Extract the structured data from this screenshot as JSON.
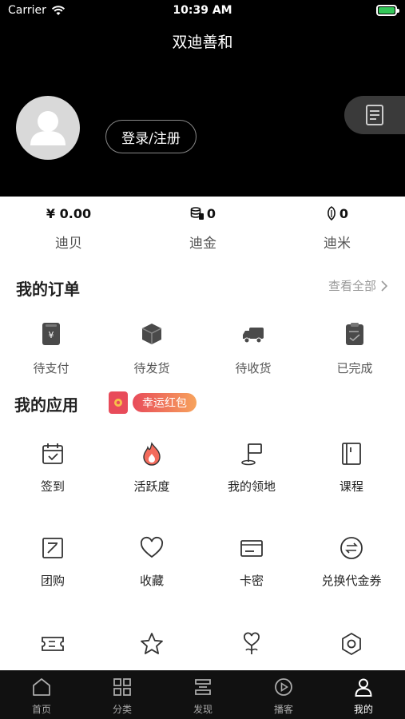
{
  "status_bar": {
    "carrier": "Carrier",
    "time": "10:39 AM"
  },
  "header": {
    "title": "双迪善和",
    "login_label": "登录/注册"
  },
  "wallet": [
    {
      "value": "¥ 0.00",
      "label": "迪贝",
      "icon": ""
    },
    {
      "value": "0",
      "label": "迪金",
      "icon": "coins-icon"
    },
    {
      "value": "0",
      "label": "迪米",
      "icon": "grain-icon"
    }
  ],
  "orders": {
    "title": "我的订单",
    "see_all": "查看全部",
    "items": [
      {
        "label": "待支付",
        "icon": "payment-icon"
      },
      {
        "label": "待发货",
        "icon": "package-icon"
      },
      {
        "label": "待收货",
        "icon": "truck-icon"
      },
      {
        "label": "已完成",
        "icon": "clipboard-check-icon"
      }
    ]
  },
  "apps": {
    "title": "我的应用",
    "badge": "幸运红包",
    "items": [
      {
        "label": "签到",
        "icon": "calendar-check-icon"
      },
      {
        "label": "活跃度",
        "icon": "flame-icon"
      },
      {
        "label": "我的领地",
        "icon": "flag-icon"
      },
      {
        "label": "课程",
        "icon": "book-icon"
      },
      {
        "label": "团购",
        "icon": "arrow-box-icon"
      },
      {
        "label": "收藏",
        "icon": "heart-icon"
      },
      {
        "label": "卡密",
        "icon": "card-icon"
      },
      {
        "label": "兑换代金券",
        "icon": "exchange-icon"
      },
      {
        "label": "",
        "icon": "ticket-icon"
      },
      {
        "label": "",
        "icon": "star-icon"
      },
      {
        "label": "",
        "icon": "heart-flower-icon"
      },
      {
        "label": "",
        "icon": "settings-hex-icon"
      }
    ]
  },
  "tabbar": {
    "items": [
      {
        "label": "首页",
        "icon": "home-icon",
        "active": false
      },
      {
        "label": "分类",
        "icon": "grid-icon",
        "active": false
      },
      {
        "label": "发现",
        "icon": "discover-icon",
        "active": false
      },
      {
        "label": "播客",
        "icon": "play-icon",
        "active": false
      },
      {
        "label": "我的",
        "icon": "user-icon",
        "active": true
      }
    ]
  },
  "colors": {
    "header_bg": "#000000",
    "badge_red": "#e84b5a",
    "tabbar_bg": "#111111"
  }
}
